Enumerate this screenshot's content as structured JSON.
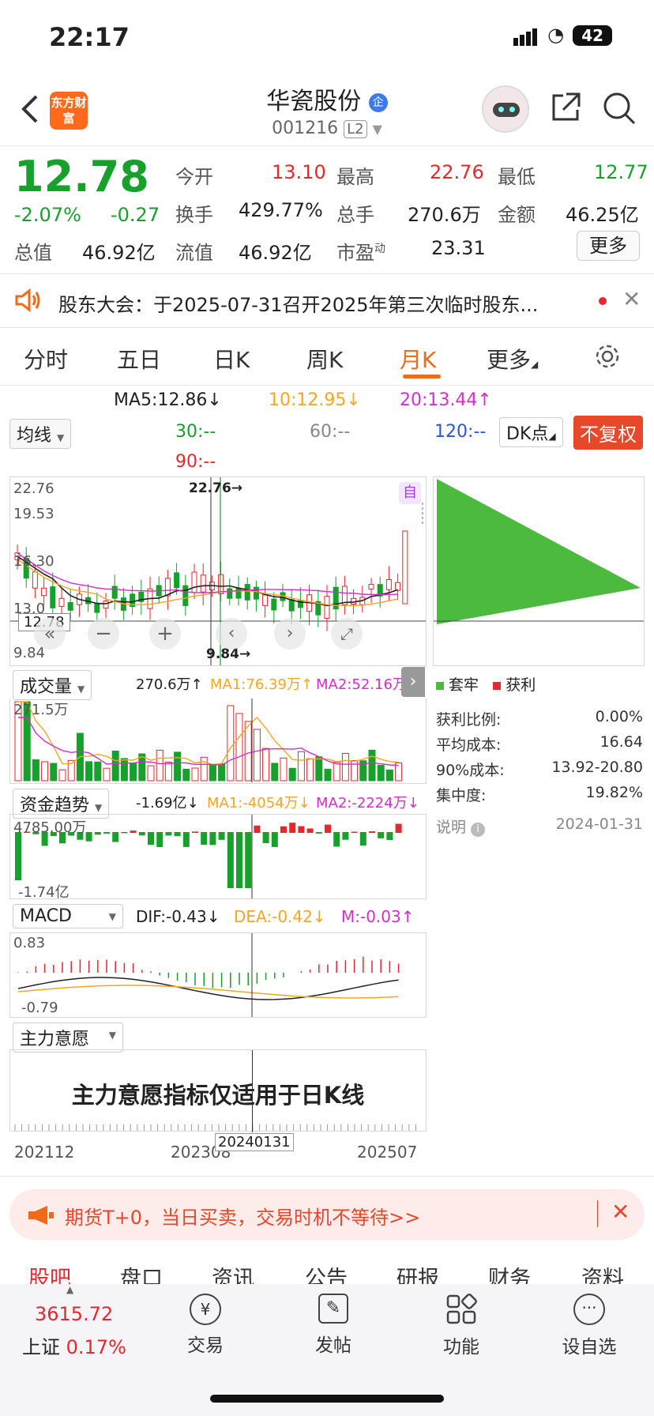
{
  "status": {
    "time": "22:17",
    "battery": "42"
  },
  "header": {
    "logo": "东方财富",
    "stock_name": "华瓷股份",
    "badge": "企",
    "code": "001216",
    "level": "L2"
  },
  "quote": {
    "price": "12.78",
    "change_pct": "-2.07%",
    "change": "-0.27",
    "open_label": "今开",
    "open": "13.10",
    "high_label": "最高",
    "high": "22.76",
    "low_label": "最低",
    "low": "12.77",
    "turnover_label": "换手",
    "turnover": "429.77%",
    "volume_label": "总手",
    "volume": "270.6万",
    "amount_label": "金额",
    "amount": "46.25亿",
    "mktcap_label": "总值",
    "mktcap": "46.92亿",
    "float_label": "流值",
    "float": "46.92亿",
    "pe_label": "市盈",
    "pe_sup": "动",
    "pe": "23.31",
    "more": "更多"
  },
  "notice": {
    "text": "股东大会：于2025-07-31召开2025年第三次临时股东..."
  },
  "ktabs": [
    "分时",
    "五日",
    "日K",
    "周K",
    "月K",
    "更多"
  ],
  "ktab_active": "月K",
  "ma": {
    "ma5": "MA5:12.86↓",
    "ma10": "10:12.95↓",
    "ma20": "20:13.44↑",
    "ma30": "30:--",
    "ma60": "60:--",
    "ma120": "120:--",
    "ma90": "90:--",
    "select": "均线",
    "dk": "DK点",
    "fq": "不复权"
  },
  "kline": {
    "y_top": "22.76",
    "y_2": "19.53",
    "y_3": "16.30",
    "y_4": "13.0",
    "cur": "12.78",
    "y_low": "9.84",
    "max_mark": "22.76→",
    "min_mark": "9.84→",
    "zi": "自"
  },
  "volume": {
    "select": "成交量",
    "value": "270.6万↑",
    "ma1": "MA1:76.39万↑",
    "ma2": "MA2:52.16万↑",
    "ymax": "271.5万"
  },
  "fund": {
    "select": "资金趋势",
    "value": "-1.69亿↓",
    "ma1": "MA1:-4054万↓",
    "ma2": "MA2:-2224万↓",
    "ymax": "4785.00万",
    "ymin": "-1.74亿"
  },
  "macd": {
    "select": "MACD",
    "dif": "DIF:-0.43↓",
    "dea": "DEA:-0.42↓",
    "m": "M:-0.03↑",
    "ymax": "0.83",
    "ymin": "-0.79"
  },
  "zlyy": {
    "select": "主力意愿",
    "msg": "主力意愿指标仅适用于日K线"
  },
  "xaxis": {
    "left": "202112",
    "mid": "202308",
    "cursor": "20240131",
    "right": "202507"
  },
  "chip": {
    "legend_trapped": "套牢",
    "legend_profit": "获利",
    "rows": [
      {
        "k": "获利比例:",
        "v": "0.00%"
      },
      {
        "k": "平均成本:",
        "v": "16.64"
      },
      {
        "k": "90%成本:",
        "v": "13.92-20.80"
      },
      {
        "k": "集中度:",
        "v": "19.82%"
      }
    ],
    "note": "说明",
    "date": "2024-01-31"
  },
  "banner": {
    "text": "期货T+0，当日买卖，交易时机不等待>>"
  },
  "subtabs": [
    "股吧",
    "盘口",
    "资讯",
    "公告",
    "研报",
    "财务",
    "资料"
  ],
  "bottom": {
    "index_value": "3615.72",
    "index_name": "上证",
    "index_change": "0.17%",
    "trade": "交易",
    "post": "发帖",
    "func": "功能",
    "watch": "设自选"
  }
}
